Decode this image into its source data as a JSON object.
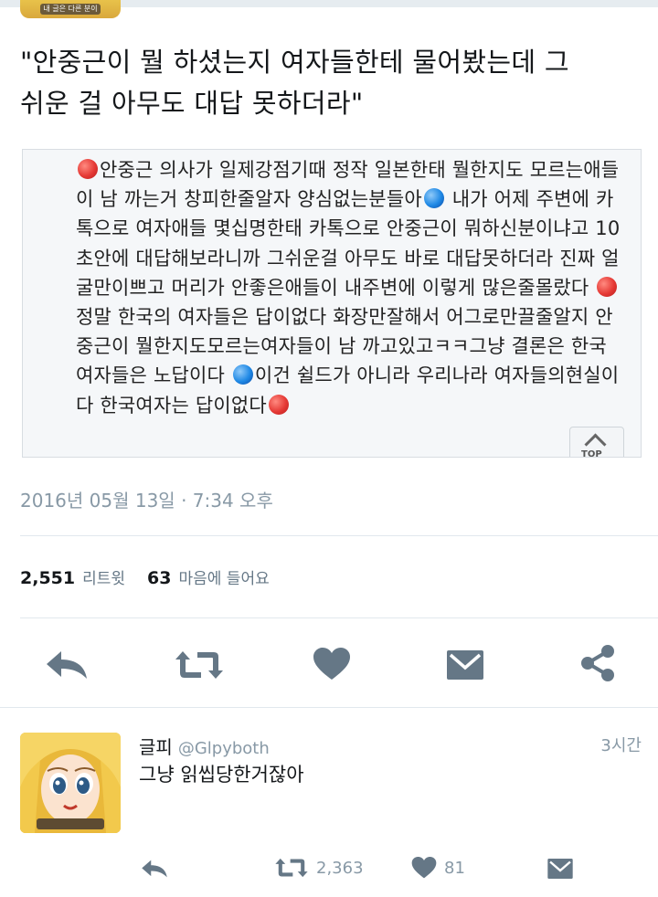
{
  "top_avatar_caption": "내 글은 다른 분이",
  "tweet": {
    "text": "\"안중근이 뭘 하셨는지 여자들한테 물어봤는데 그\n쉬운 걸 아무도 대답 못하더라\"",
    "timestamp": "2016년 05월 13일 · 7:34 오후"
  },
  "screenshot": {
    "segments": [
      {
        "dot": "red"
      },
      {
        "text": "안중근 의사가 일제강점기때 정작 일본한태 뭘한지도 모르는애들이 남 까는거 창피한줄알자 양심없는분들아"
      },
      {
        "dot": "blue"
      },
      {
        "text": " 내가 어제 주변에 카톡으로 여자애들 몇십명한태 카톡으로 안중근이 뭐하신분이냐고 10초안에 대답해보라니까 그쉬운걸 아무도 바로 대답못하더라 진짜 얼굴만이쁘고 머리가 안좋은애들이 내주변에 이렇게 많은줄몰랐다 "
      },
      {
        "dot": "red"
      },
      {
        "text": "정말 한국의 여자들은 답이없다 화장만잘해서 어그로만끌줄알지 안중근이 뭘한지도모르는여자들이 남 까고있고ㅋㅋ그냥 결론은 한국여자들은 노답이다 "
      },
      {
        "dot": "blue"
      },
      {
        "text": "이건 쉴드가 아니라 우리나라 여자들의현실이다 한국여자는 답이없다"
      },
      {
        "dot": "red"
      }
    ],
    "top_button_label": "TOP",
    "dot_colors": {
      "red": "#e53935",
      "blue": "#1e88e5"
    }
  },
  "stats": {
    "retweets": "2,551",
    "retweets_label": "리트윗",
    "likes": "63",
    "likes_label": "마음에 들어요"
  },
  "actions": {
    "icons": [
      "reply-icon",
      "retweet-icon",
      "heart-icon",
      "message-icon",
      "share-icon"
    ],
    "color": "#657786"
  },
  "reply": {
    "name": "글피",
    "handle": "@Glpyboth",
    "time": "3시간",
    "text": "그냥 읽씹당한거잖아",
    "avatar_caption": "내 글은 다른 분이",
    "retweet_count": "2,363",
    "like_count": "81"
  }
}
